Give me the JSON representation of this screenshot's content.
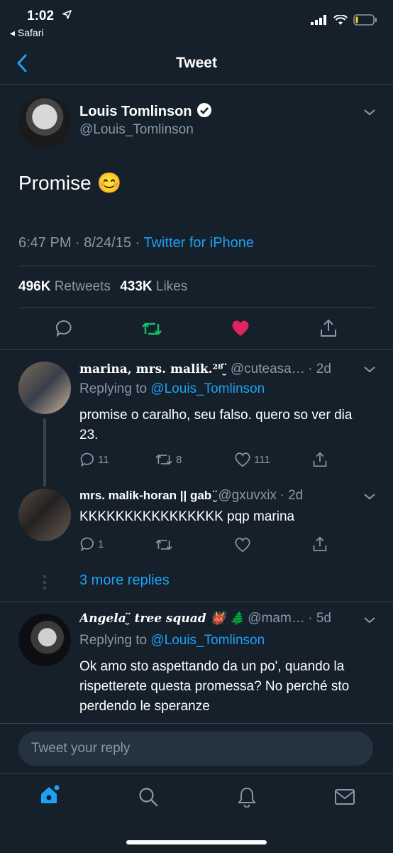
{
  "status": {
    "time": "1:02",
    "back_app": "◂ Safari"
  },
  "nav": {
    "title": "Tweet"
  },
  "tweet": {
    "name": "Louis Tomlinson",
    "handle": "@Louis_Tomlinson",
    "text": "Promise 😊",
    "timestamp": "6:47 PM · 8/24/15 · ",
    "source": "Twitter for iPhone",
    "retweets": "496K",
    "retweets_label": "Retweets",
    "likes": "433K",
    "likes_label": "Likes"
  },
  "replies": [
    {
      "name": "marina, mrs. malik.²⁸ ̮̈",
      "handle": "@cuteasa…",
      "time": "· 2d",
      "replying": "Replying to ",
      "replying_to": "@Louis_Tomlinson",
      "text": "promise o caralho, seu falso. quero so ver dia 23.",
      "comments": "11",
      "retweets": "8",
      "likes": "111"
    },
    {
      "name": "mrs. malik-horan || gab ̮̈",
      "handle": "@gxuvxix",
      "time": "· 2d",
      "text": "KKKKKKKKKKKKKKKK pqp marina",
      "comments": "1",
      "retweets": "",
      "likes": ""
    },
    {
      "more": "3 more replies"
    },
    {
      "name": "Angela ̮̈ tree squad 👹 🌲",
      "handle": "@mam…",
      "time": "· 5d",
      "replying": "Replying to ",
      "replying_to": "@Louis_Tomlinson",
      "text": "Ok amo sto aspettando da un po', quando la rispetterete questa promessa? No perché sto perdendo le speranze"
    }
  ],
  "composer": {
    "placeholder": "Tweet your reply"
  },
  "colors": {
    "accent": "#1da1f2",
    "retweet_green": "#17bf63",
    "like_red": "#e0245e",
    "background": "#15202b"
  }
}
